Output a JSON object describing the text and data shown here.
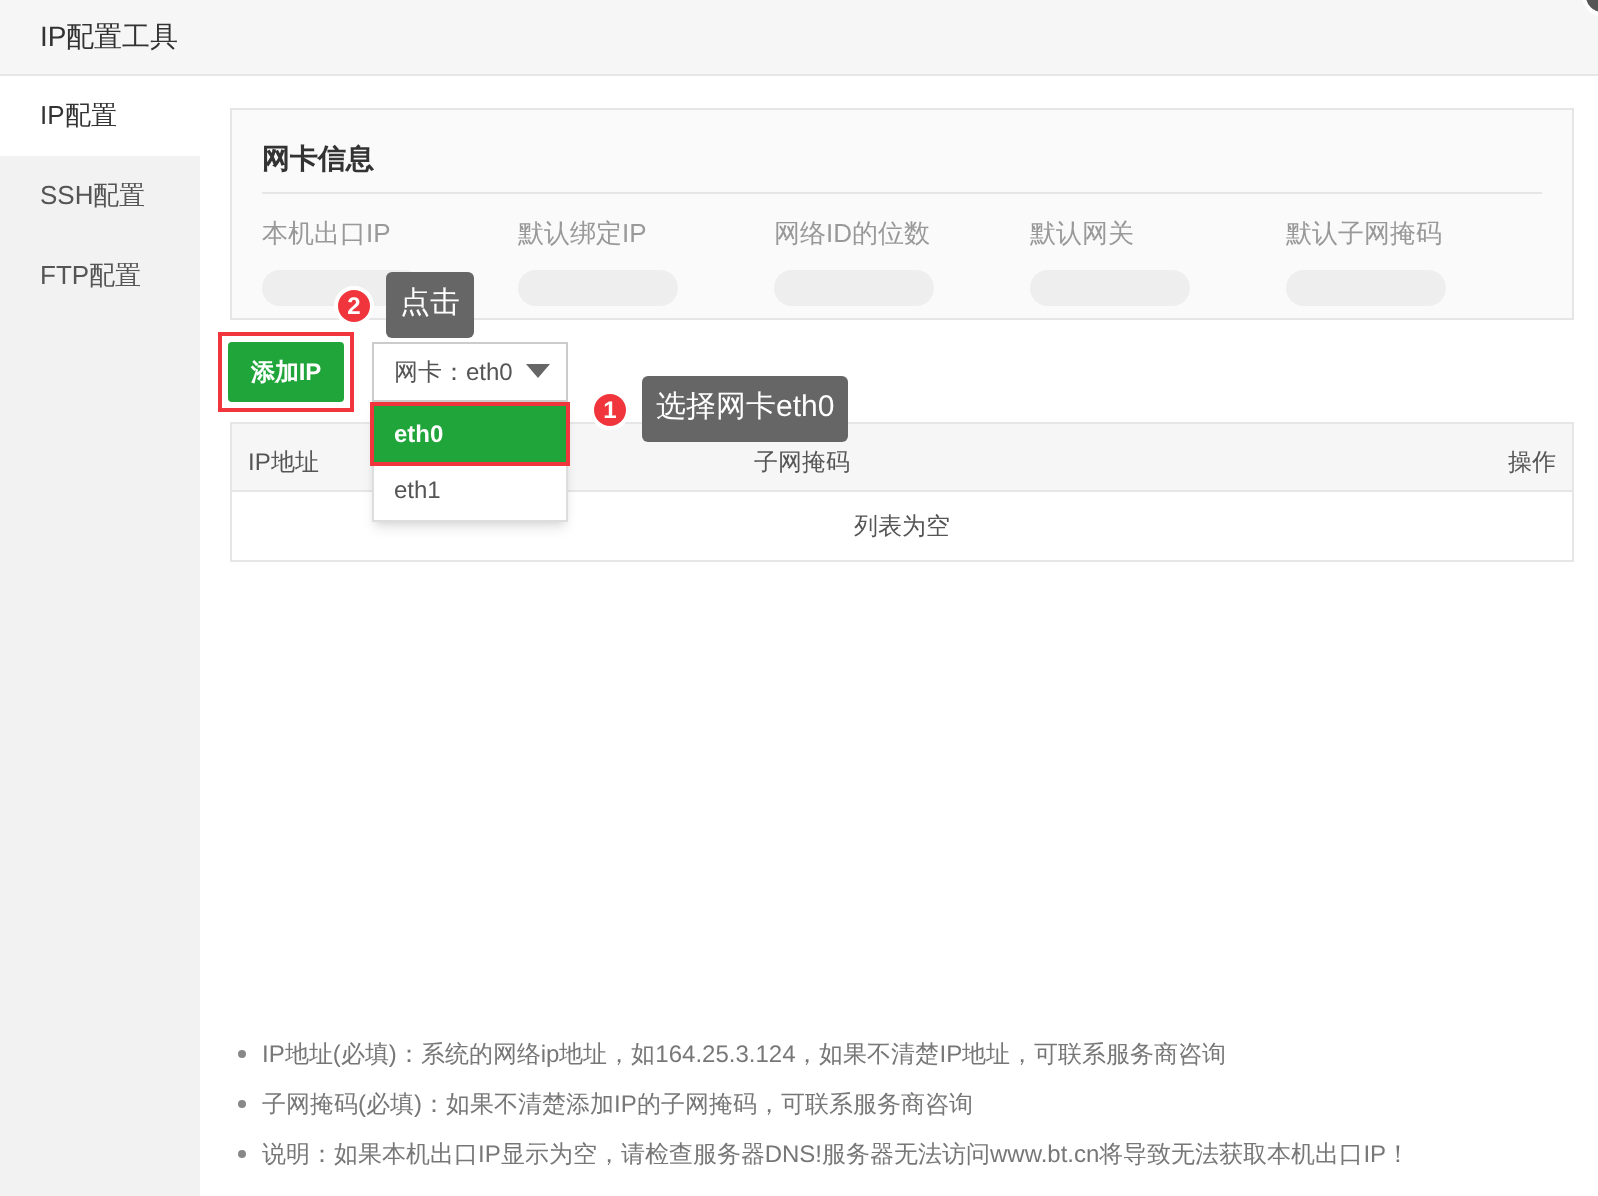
{
  "window": {
    "title": "IP配置工具"
  },
  "sidebar": {
    "items": [
      {
        "label": "IP配置",
        "selected": true
      },
      {
        "label": "SSH配置",
        "selected": false
      },
      {
        "label": "FTP配置",
        "selected": false
      }
    ]
  },
  "info_card": {
    "title": "网卡信息",
    "fields": [
      "本机出口IP",
      "默认绑定IP",
      "网络ID的位数",
      "默认网关",
      "默认子网掩码"
    ]
  },
  "add_button": {
    "label": "添加IP"
  },
  "nic_select": {
    "value": "网卡：eth0",
    "expanded": true,
    "options": [
      {
        "label": "eth0",
        "selected": true
      },
      {
        "label": "eth1",
        "selected": false
      }
    ]
  },
  "callouts": [
    {
      "number": "2",
      "text": "点击"
    },
    {
      "number": "1",
      "text": "选择网卡eth0"
    }
  ],
  "table": {
    "columns": [
      "IP地址",
      "子网掩码",
      "操作"
    ],
    "empty_text": "列表为空"
  },
  "notes": [
    "IP地址(必填)：系统的网络ip地址，如164.25.3.124，如果不清楚IP地址，可联系服务商咨询",
    "子网掩码(必填)：如果不清楚添加IP的子网掩码，可联系服务商咨询",
    "说明：如果本机出口IP显示为空，请检查服务器DNS!服务器无法访问www.bt.cn将导致无法获取本机出口IP！"
  ]
}
